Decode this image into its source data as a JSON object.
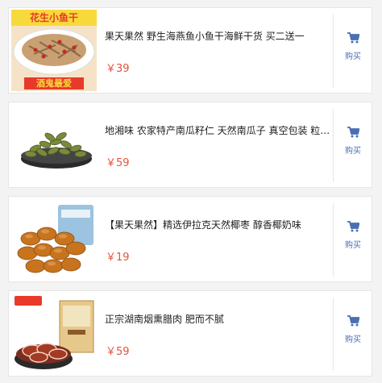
{
  "products": [
    {
      "title": "果天果然 野生海燕鱼小鱼干海鲜干货 买二送一",
      "price": "￥39",
      "buy_label": "购买",
      "image_banner_top": "花生小鱼干",
      "image_banner_bottom": "酒鬼最爱"
    },
    {
      "title": "地湘味 农家特产南瓜籽仁 天然南瓜子 真空包装 粒…",
      "price": "￥59",
      "buy_label": "购买"
    },
    {
      "title": "【果天果然】精选伊拉克天然椰枣 醇香椰奶味",
      "price": "￥19",
      "buy_label": "购买"
    },
    {
      "title": "正宗湖南烟熏腊肉 肥而不腻",
      "price": "￥59",
      "buy_label": "购买"
    }
  ],
  "colors": {
    "price": "#e5533b",
    "cart_icon": "#4a6fb3",
    "banner_red": "#e8392b",
    "banner_yellow": "#f7d93b"
  },
  "icons": {
    "buy": "shopping-cart-icon"
  }
}
